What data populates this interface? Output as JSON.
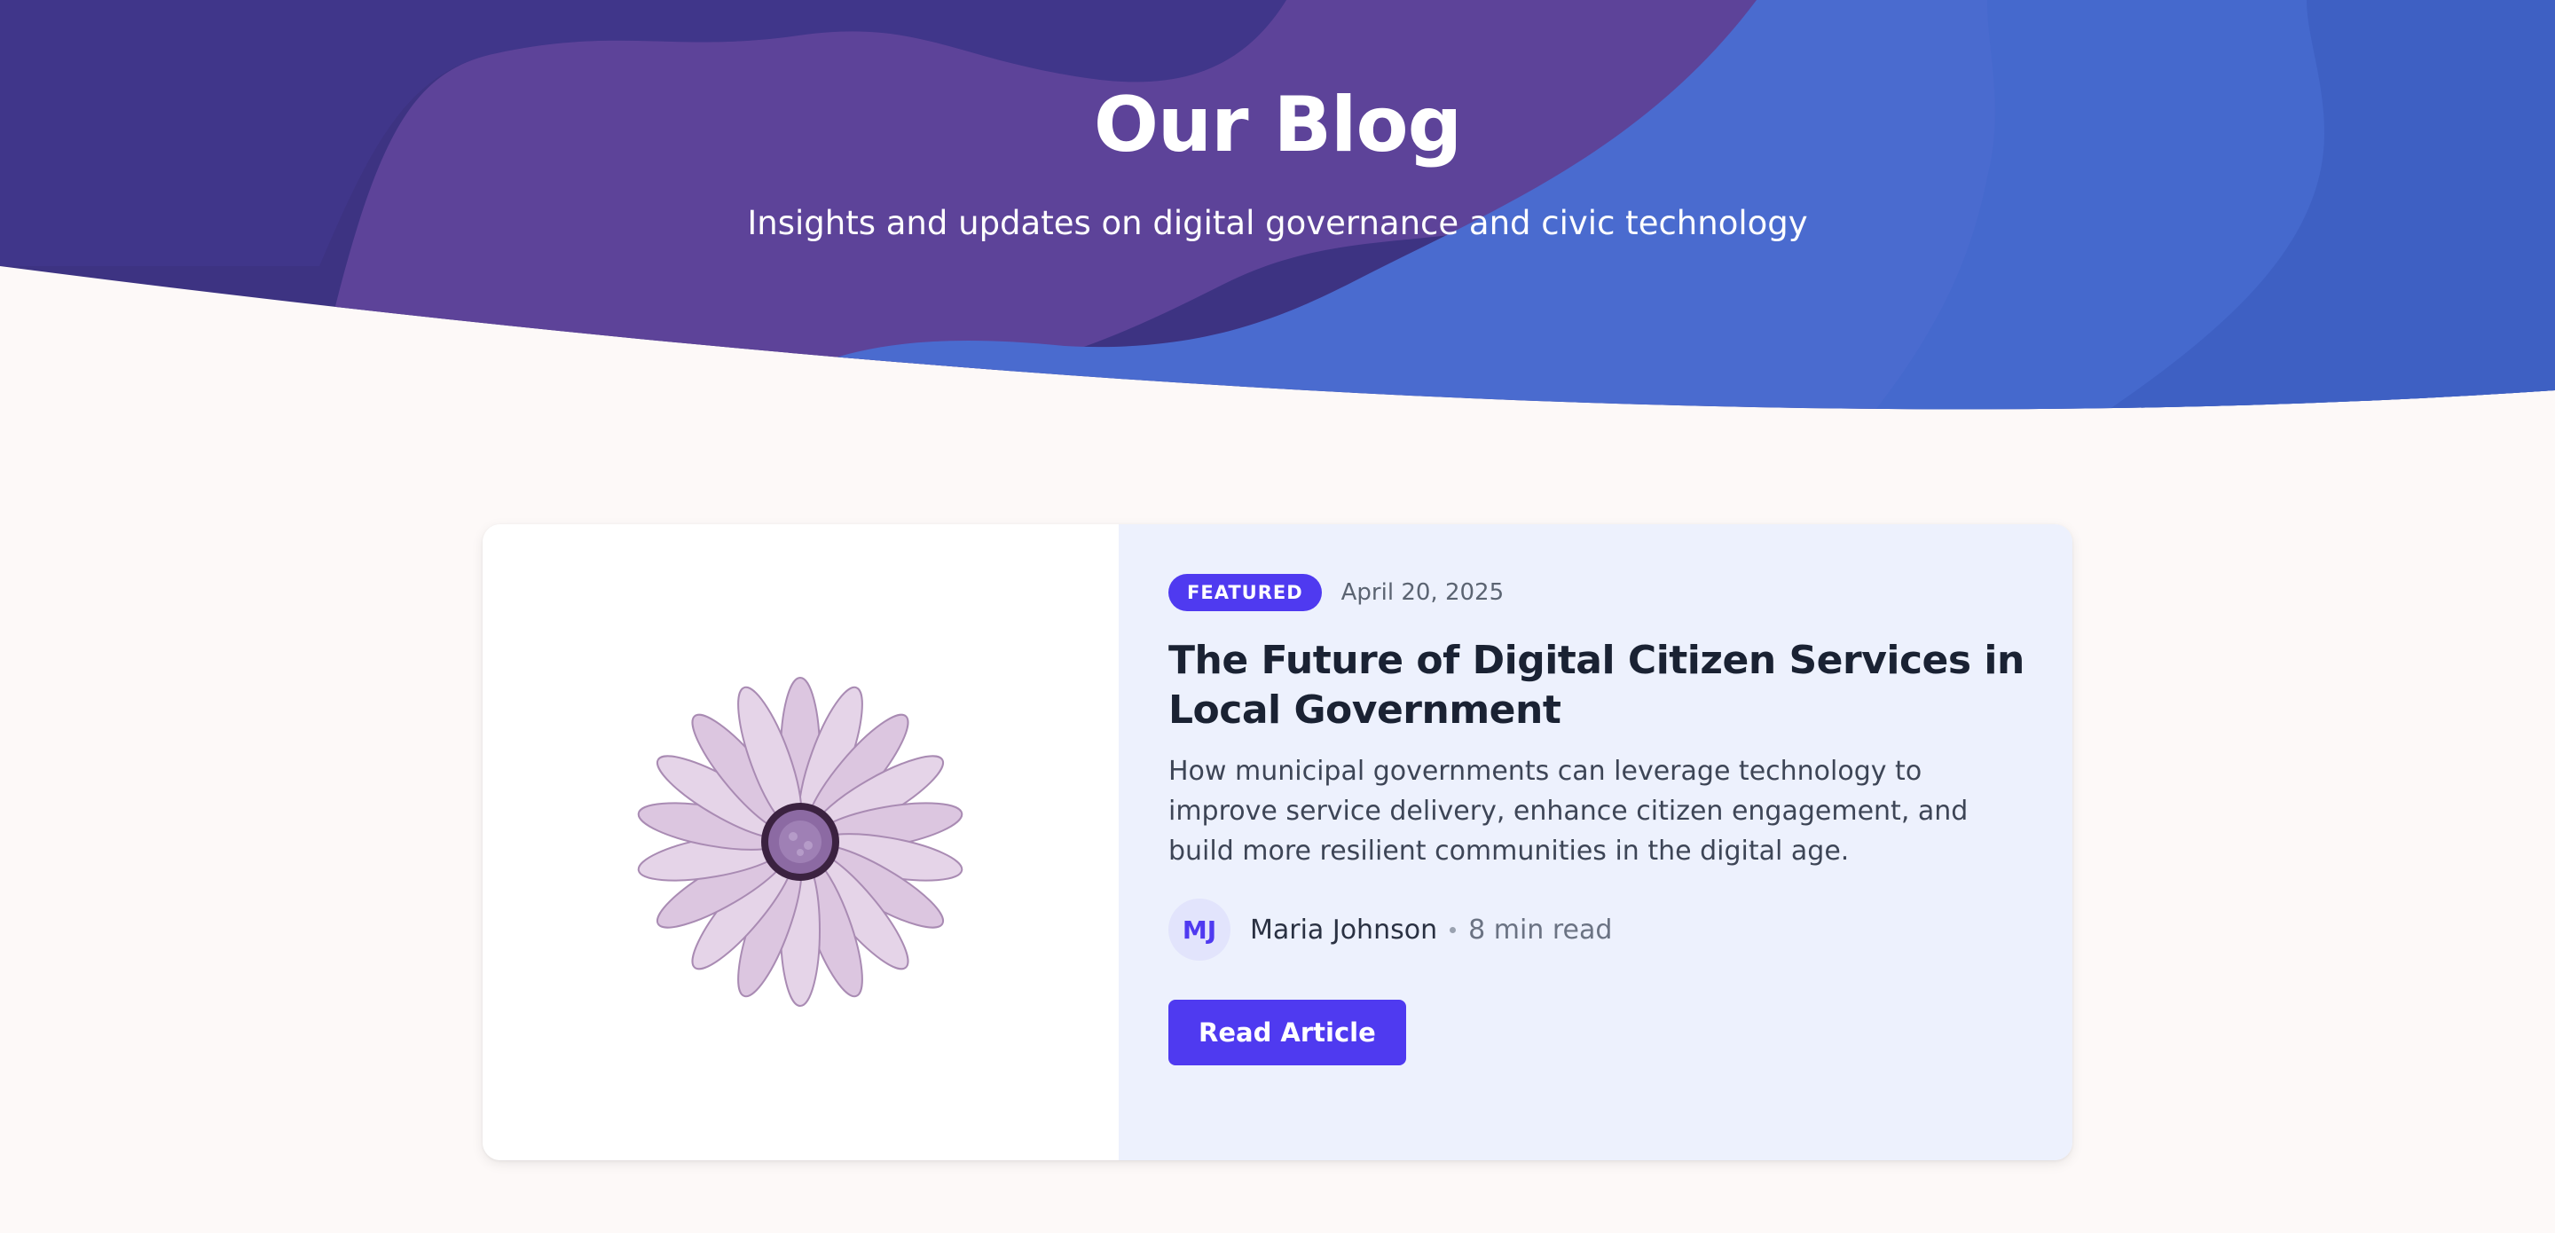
{
  "hero": {
    "title": "Our Blog",
    "subtitle": "Insights and updates on digital governance and civic technology"
  },
  "featured_post": {
    "badge": "FEATURED",
    "date": "April 20, 2025",
    "title": "The Future of Digital Citizen Services in Local Government",
    "excerpt": "How municipal governments can leverage technology to improve service delivery, enhance citizen engagement, and build more resilient communities in the digital age.",
    "author": {
      "initials": "MJ",
      "name": "Maria Johnson"
    },
    "read_time": "8 min read",
    "cta_label": "Read Article",
    "image_icon": "daisy-flower-icon"
  },
  "colors": {
    "hero_dark_purple": "#3f3585",
    "hero_purple": "#5d4399",
    "hero_blue": "#4a6fd0",
    "accent": "#4f3af0",
    "page_background": "#fdf9f8",
    "card_panel": "#edf1fd",
    "heading_text": "#1a2233"
  }
}
